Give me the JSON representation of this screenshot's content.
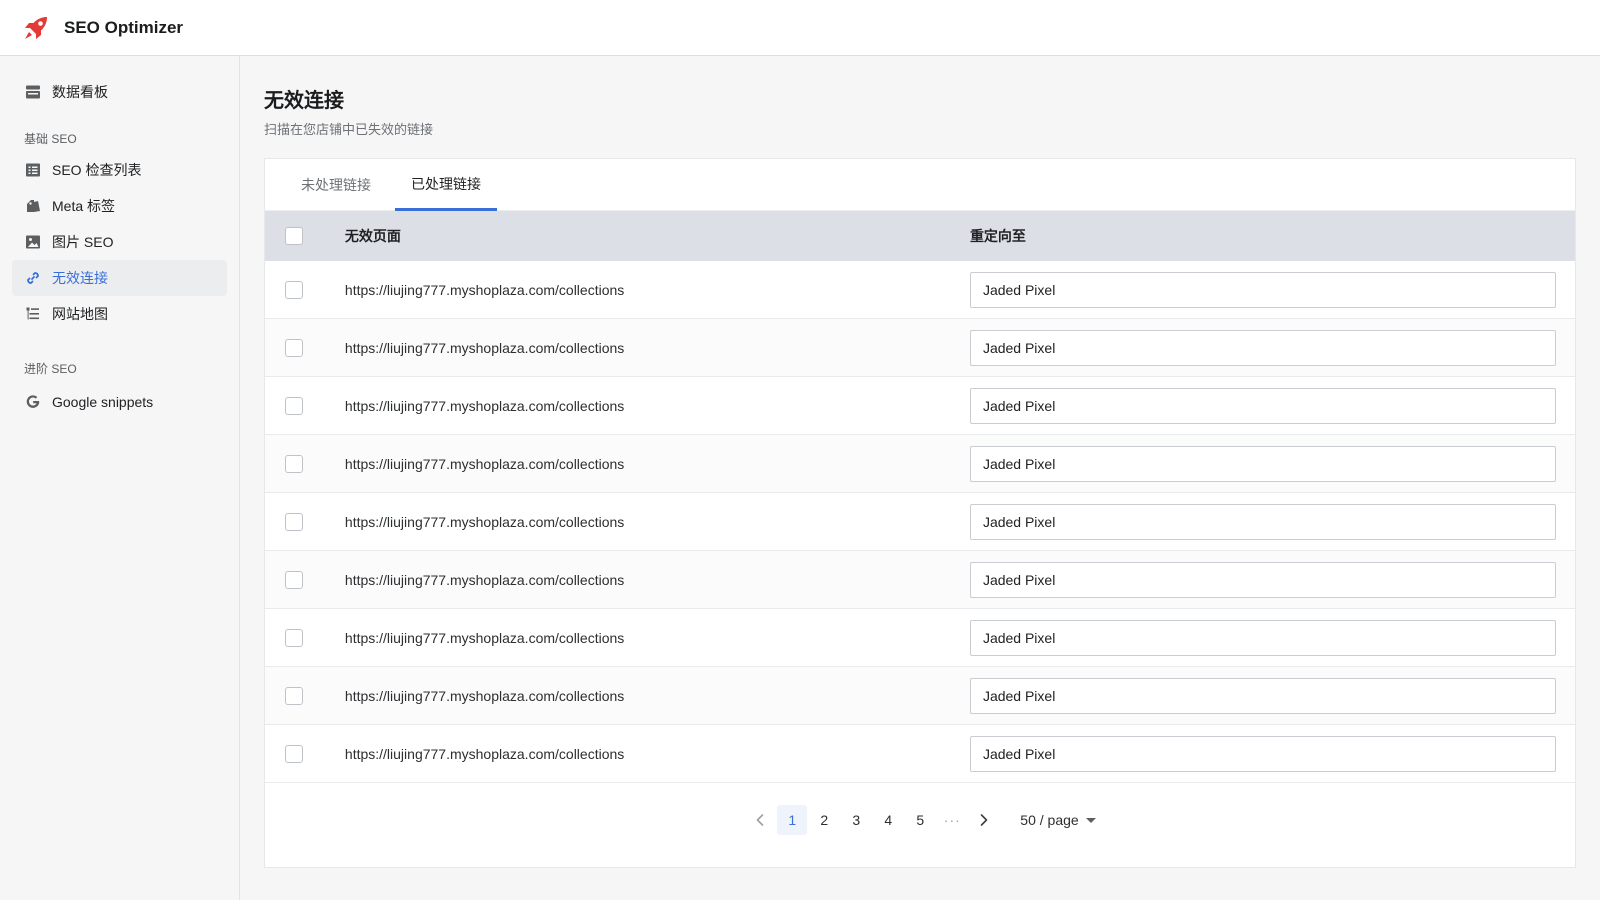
{
  "header": {
    "app_title": "SEO Optimizer",
    "logo_icon": "rocket-icon",
    "logo_color": "#e53935"
  },
  "sidebar": {
    "dashboard": {
      "label": "数据看板",
      "icon": "dashboard-icon"
    },
    "section_basic": "基础 SEO",
    "basic_items": [
      {
        "label": "SEO 检查列表",
        "icon": "checklist-icon"
      },
      {
        "label": "Meta 标签",
        "icon": "tag-icon"
      },
      {
        "label": "图片 SEO",
        "icon": "image-icon"
      },
      {
        "label": "无效连接",
        "icon": "link-icon",
        "active": true
      },
      {
        "label": "网站地图",
        "icon": "sitemap-icon"
      }
    ],
    "section_advanced": "进阶 SEO",
    "advanced_items": [
      {
        "label": "Google snippets",
        "icon": "google-icon"
      }
    ]
  },
  "main": {
    "title": "无效连接",
    "subtitle": "扫描在您店铺中已失效的链接",
    "tabs": [
      {
        "label": "未处理链接",
        "active": false
      },
      {
        "label": "已处理链接",
        "active": true
      }
    ],
    "table": {
      "columns": [
        "无效页面",
        "重定向至"
      ],
      "rows": [
        {
          "page": "https://liujing777.myshoplaza.com/collections",
          "redirect": "Jaded Pixel"
        },
        {
          "page": "https://liujing777.myshoplaza.com/collections",
          "redirect": "Jaded Pixel"
        },
        {
          "page": "https://liujing777.myshoplaza.com/collections",
          "redirect": "Jaded Pixel"
        },
        {
          "page": "https://liujing777.myshoplaza.com/collections",
          "redirect": "Jaded Pixel"
        },
        {
          "page": "https://liujing777.myshoplaza.com/collections",
          "redirect": "Jaded Pixel"
        },
        {
          "page": "https://liujing777.myshoplaza.com/collections",
          "redirect": "Jaded Pixel"
        },
        {
          "page": "https://liujing777.myshoplaza.com/collections",
          "redirect": "Jaded Pixel"
        },
        {
          "page": "https://liujing777.myshoplaza.com/collections",
          "redirect": "Jaded Pixel"
        },
        {
          "page": "https://liujing777.myshoplaza.com/collections",
          "redirect": "Jaded Pixel"
        }
      ]
    },
    "pagination": {
      "pages": [
        "1",
        "2",
        "3",
        "4",
        "5"
      ],
      "current": "1",
      "ellipsis": "···",
      "page_size": "50 / page"
    }
  },
  "colors": {
    "accent": "#3b6fd8",
    "header_row": "#dcdfe5"
  }
}
